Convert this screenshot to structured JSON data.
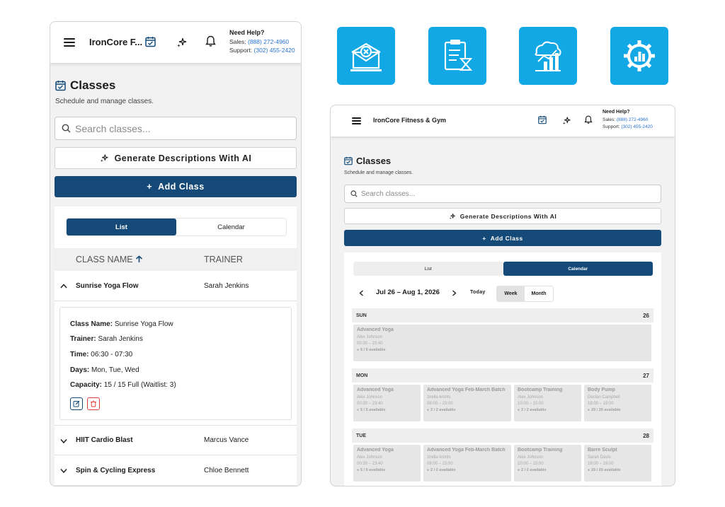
{
  "app": {
    "brand_short": "IronCore F...",
    "brand_full": "IronCore Fitness & Gym",
    "help_title": "Need Help?",
    "sales_label": "Sales:",
    "sales_phone": "(888) 272-4960",
    "support_label": "Support:",
    "support_phone": "(302) 455-2420"
  },
  "page": {
    "title": "Classes",
    "subtitle": "Schedule and manage classes.",
    "search_placeholder": "Search classes...",
    "generate_label": "Generate Descriptions With AI",
    "add_label": "Add Class",
    "add_plus": "+"
  },
  "view_toggle": {
    "list": "List",
    "calendar": "Calendar"
  },
  "table": {
    "col_name": "CLASS NAME",
    "col_trainer": "TRAINER",
    "rows": [
      {
        "name": "Sunrise Yoga Flow",
        "trainer": "Sarah Jenkins",
        "expanded": true
      },
      {
        "name": "HIIT Cardio Blast",
        "trainer": "Marcus Vance",
        "expanded": false
      },
      {
        "name": "Spin & Cycling Express",
        "trainer": "Chloe Bennett",
        "expanded": false
      }
    ]
  },
  "detail": {
    "name_label": "Class Name:",
    "name": "Sunrise Yoga Flow",
    "trainer_label": "Trainer:",
    "trainer": "Sarah Jenkins",
    "time_label": "Time:",
    "time": "06:30 - 07:30",
    "days_label": "Days:",
    "days": "Mon, Tue, Wed",
    "capacity_label": "Capacity:",
    "capacity": "15 / 15 Full (Waitlist: 3)"
  },
  "calendar": {
    "range": "Jul 26 – Aug 1, 2026",
    "today": "Today",
    "week": "Week",
    "month": "Month",
    "days": [
      {
        "label": "SUN",
        "num": "26",
        "classes": [
          {
            "name": "Advanced Yoga",
            "trainer": "Alex Johnson",
            "time": "00:30 – 23:40",
            "avail": "5 / 5 available"
          }
        ]
      },
      {
        "label": "MON",
        "num": "27",
        "classes": [
          {
            "name": "Advanced Yoga",
            "trainer": "Alex Johnson",
            "time": "00:30 – 23:40",
            "avail": "5 / 5 available"
          },
          {
            "name": "Advanced Yoga Feb-March Batch",
            "trainer": "zirella kronts",
            "time": "08:00 – 23:00",
            "avail": "2 / 2 available"
          },
          {
            "name": "Bootcamp Training",
            "trainer": "Alex Johnson",
            "time": "10:00 – 15:00",
            "avail": "2 / 2 available"
          },
          {
            "name": "Body Pump",
            "trainer": "Declan Campbell",
            "time": "18:00 – 19:00",
            "avail": "20 / 20 available"
          }
        ]
      },
      {
        "label": "TUE",
        "num": "28",
        "classes": [
          {
            "name": "Advanced Yoga",
            "trainer": "Alex Johnson",
            "time": "00:30 – 23:40",
            "avail": "5 / 5 available"
          },
          {
            "name": "Advanced Yoga Feb-March Batch",
            "trainer": "zirella kronts",
            "time": "08:00 – 23:00",
            "avail": "2 / 2 available"
          },
          {
            "name": "Bootcamp Training",
            "trainer": "Alex Johnson",
            "time": "10:00 – 15:00",
            "avail": "2 / 2 available"
          },
          {
            "name": "Barre Sculpt",
            "trainer": "Sarah Davis",
            "time": "18:00 – 19:00",
            "avail": "20 / 20 available"
          }
        ]
      }
    ]
  },
  "tiles": [
    "mail-cancel-icon",
    "clipboard-hourglass-icon",
    "chart-growth-icon",
    "gear-chart-icon"
  ],
  "colors": {
    "primary": "#154a78",
    "tile": "#12a8e6",
    "link": "#2a73d2",
    "danger": "#e23b3b"
  }
}
